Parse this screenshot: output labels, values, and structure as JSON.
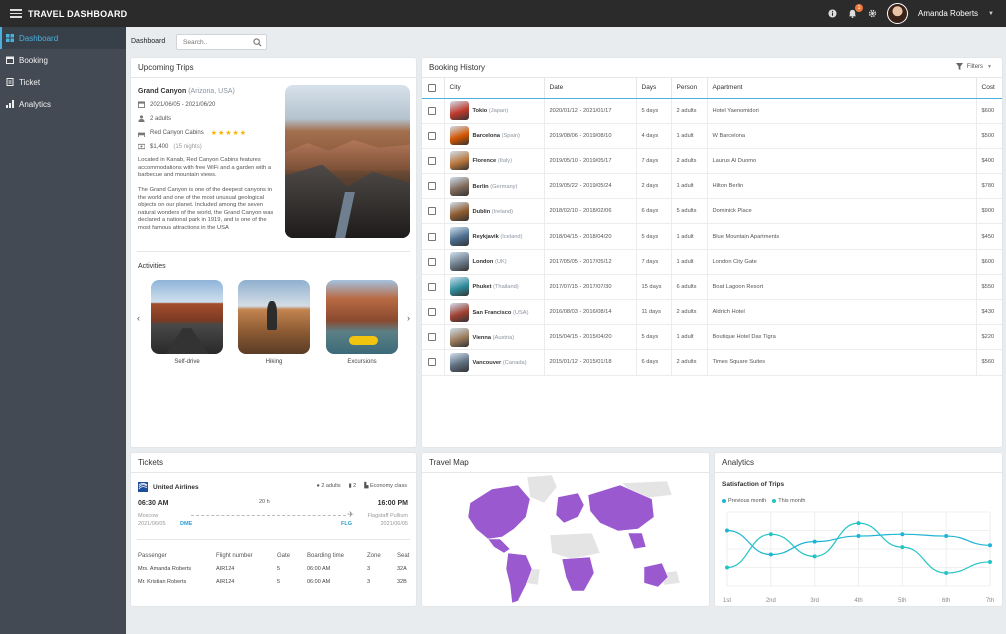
{
  "app": {
    "title": "TRAVEL DASHBOARD"
  },
  "user": {
    "name": "Amanda Roberts",
    "notifications": "1"
  },
  "sidebar": {
    "items": [
      {
        "label": "Dashboard",
        "icon": "dashboard-icon",
        "active": true
      },
      {
        "label": "Booking",
        "icon": "calendar-icon"
      },
      {
        "label": "Ticket",
        "icon": "ticket-icon"
      },
      {
        "label": "Analytics",
        "icon": "bar-chart-icon"
      }
    ]
  },
  "breadcrumb": "Dashboard",
  "search": {
    "placeholder": "Search.."
  },
  "upcoming": {
    "title": "Upcoming Trips",
    "name": "Grand Canyon",
    "location": "(Arizona, USA)",
    "dates": "2021/06/05 - 2021/06/20",
    "guests": "2 adults",
    "hotel": "Red Canyon Cabins",
    "stars": "★★★★★",
    "price": "$1,400",
    "nights": "(15 nights)",
    "desc1": "Located in Kanab, Red Canyon Cabins features accommodations with free WiFi and a garden with a barbecue and mountain views.",
    "desc2": "The Grand Canyon is one of the deepest canyons in the world and one of the most unusual geological objects on our planet. Included among the seven natural wonders of the world, the Grand Canyon was declared a national park in 1919, and is one of the most famous attractions in the USA",
    "activities_title": "Activities",
    "activities": [
      "Self-drive",
      "Hiking",
      "Excursions"
    ]
  },
  "booking": {
    "title": "Booking History",
    "filters": "Filters",
    "columns": [
      "City",
      "Date",
      "Days",
      "Person",
      "Apartment",
      "Cost"
    ],
    "rows": [
      {
        "city": "Tokio",
        "country": "(Japan)",
        "date": "2020/01/12 - 2021/01/17",
        "days": "5 days",
        "person": "2 adults",
        "apt": "Hotel Yaenomidori",
        "cost": "$600",
        "color": "#c0392b"
      },
      {
        "city": "Barcelona",
        "country": "(Spain)",
        "date": "2019/08/06 - 2019/08/10",
        "days": "4 days",
        "person": "1 adult",
        "apt": "W Barcelona",
        "cost": "$500",
        "color": "#d35400"
      },
      {
        "city": "Florence",
        "country": "(Italy)",
        "date": "2019/05/10 - 2019/05/17",
        "days": "7 days",
        "person": "2 adults",
        "apt": "Laurus Al Duomo",
        "cost": "$400",
        "color": "#b9773d"
      },
      {
        "city": "Berlin",
        "country": "(Germany)",
        "date": "2019/05/22 - 2019/05/24",
        "days": "2 days",
        "person": "1 adult",
        "apt": "Hilton Berlin",
        "cost": "$780",
        "color": "#7f6a5a"
      },
      {
        "city": "Dublin",
        "country": "(Ireland)",
        "date": "2018/02/10 - 2018/02/06",
        "days": "6 days",
        "person": "5 adults",
        "apt": "Dominick Place",
        "cost": "$900",
        "color": "#8e5b2e"
      },
      {
        "city": "Reykjavik",
        "country": "(Iceland)",
        "date": "2018/04/15 - 2018/04/20",
        "days": "5 days",
        "person": "1 adult",
        "apt": "Blue Mountain Apartments",
        "cost": "$450",
        "color": "#4a6c8c"
      },
      {
        "city": "London",
        "country": "(UK)",
        "date": "2017/05/05 - 2017/05/12",
        "days": "7 days",
        "person": "1 adult",
        "apt": "London City Gate",
        "cost": "$600",
        "color": "#6d7b8a"
      },
      {
        "city": "Phuket",
        "country": "(Thailand)",
        "date": "2017/07/15 - 2017/07/30",
        "days": "15 days",
        "person": "6 adults",
        "apt": "Boat Lagoon Resort",
        "cost": "$550",
        "color": "#2e8b9a"
      },
      {
        "city": "San Francisco",
        "country": "(USA)",
        "date": "2016/08/03 - 2016/08/14",
        "days": "11 days",
        "person": "2 adults",
        "apt": "Aldrich Hotel",
        "cost": "$430",
        "color": "#a04032"
      },
      {
        "city": "Vienna",
        "country": "(Austria)",
        "date": "2015/04/15 - 2015/04/20",
        "days": "5 days",
        "person": "1 adult",
        "apt": "Boutique Hotel Dax Tigra",
        "cost": "$220",
        "color": "#9b7b5a"
      },
      {
        "city": "Vancouver",
        "country": "(Canada)",
        "date": "2015/01/12 - 2015/01/18",
        "days": "6 days",
        "person": "2 adults",
        "apt": "Times Square Suites",
        "cost": "$560",
        "color": "#5d6d7e"
      }
    ]
  },
  "tickets": {
    "title": "Tickets",
    "airline": "United Airlines",
    "adults": "2 adults",
    "bags": "2",
    "class": "Economy class",
    "dep_time": "06:30 AM",
    "duration": "20 h",
    "arr_time": "16:00 PM",
    "from_city": "Moscow",
    "to_city": "Flagstaff Pullium",
    "dep_date": "2021/06/05",
    "arr_date": "2021/06/05",
    "from_code": "DME",
    "to_code": "FLG",
    "columns": [
      "Passenger",
      "Flight number",
      "Gate",
      "Boarding time",
      "Zone",
      "Seat"
    ],
    "passengers": [
      [
        "Mrs. Amanda Roberts",
        "AIR124",
        "5",
        "06:00 AM",
        "3",
        "32A"
      ],
      [
        "Mr. Kristian Roberts",
        "AIR124",
        "5",
        "06:00 AM",
        "3",
        "32B"
      ]
    ]
  },
  "map": {
    "title": "Travel Map",
    "visited_color": "#9b59d0"
  },
  "analytics": {
    "title": "Analytics",
    "chart_data": {
      "type": "line",
      "title": "Satisfaction of Trips",
      "categories": [
        "1st",
        "2nd",
        "3rd",
        "4th",
        "5th",
        "6th",
        "7th"
      ],
      "series": [
        {
          "name": "Previous month",
          "values": [
            4.0,
            2.7,
            3.4,
            3.7,
            3.8,
            3.7,
            3.2
          ],
          "color": "#1fb5d2"
        },
        {
          "name": "This month",
          "values": [
            2.0,
            3.8,
            2.6,
            4.4,
            3.1,
            1.7,
            2.3
          ],
          "color": "#23c4c4"
        }
      ],
      "ylim": [
        1,
        5
      ],
      "grid": true,
      "legend": "top-left"
    }
  }
}
